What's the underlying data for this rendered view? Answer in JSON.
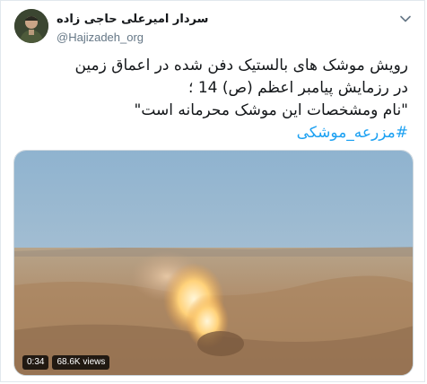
{
  "header": {
    "display_name": "سردار امیرعلی حاجی زاده",
    "handle": "@Hajizadeh_org"
  },
  "tweet": {
    "lines": [
      "رویش موشک های بالستیک دفن شده در اعماق زمین",
      "در رزمایش پیامبر اعظم (ص) 14 ؛",
      "\"نام ومشخصات این موشک محرمانه است\""
    ],
    "hashtag": "#مزرعه_موشکی"
  },
  "media": {
    "duration": "0:34",
    "views": "68.6K views"
  },
  "colors": {
    "link": "#1da1f2",
    "text": "#14171a",
    "secondary": "#657786"
  },
  "icons": {
    "menu": "chevron-down-icon",
    "avatar": "avatar"
  }
}
